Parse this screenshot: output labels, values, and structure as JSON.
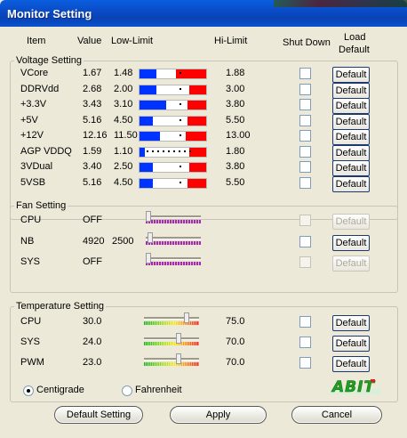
{
  "window": {
    "title": "Monitor Setting"
  },
  "headers": {
    "item": "Item",
    "value": "Value",
    "low_limit": "Low-Limit",
    "hi_limit": "Hi-Limit",
    "shut_down": "Shut Down",
    "load_default_1": "Load",
    "load_default_2": "Default"
  },
  "voltage": {
    "legend": "Voltage Setting",
    "rows": [
      {
        "item": "VCore",
        "value": "1.67",
        "low": "1.48",
        "hi": "1.88",
        "blue_pct": 0.25,
        "red_pct": 0.45,
        "default": "Default"
      },
      {
        "item": "DDRVdd",
        "value": "2.68",
        "low": "2.00",
        "hi": "3.00",
        "blue_pct": 0.25,
        "red_pct": 0.25,
        "default": "Default"
      },
      {
        "item": "+3.3V",
        "value": "3.43",
        "low": "3.10",
        "hi": "3.80",
        "blue_pct": 0.4,
        "red_pct": 0.28,
        "default": "Default"
      },
      {
        "item": "+5V",
        "value": "5.16",
        "low": "4.50",
        "hi": "5.50",
        "blue_pct": 0.2,
        "red_pct": 0.28,
        "default": "Default"
      },
      {
        "item": "+12V",
        "value": "12.16",
        "low": "11.50",
        "hi": "13.00",
        "blue_pct": 0.3,
        "red_pct": 0.3,
        "default": "Default"
      },
      {
        "item": "AGP VDDQ",
        "value": "1.59",
        "low": "1.10",
        "hi": "1.80",
        "blue_pct": 0.08,
        "red_pct": 0.25,
        "default": "Default"
      },
      {
        "item": "3VDual",
        "value": "3.40",
        "low": "2.50",
        "hi": "3.80",
        "blue_pct": 0.2,
        "red_pct": 0.25,
        "default": "Default"
      },
      {
        "item": "5VSB",
        "value": "5.16",
        "low": "4.50",
        "hi": "5.50",
        "blue_pct": 0.2,
        "red_pct": 0.28,
        "default": "Default"
      }
    ]
  },
  "fan": {
    "legend": "Fan Setting",
    "rows": [
      {
        "item": "CPU",
        "value": "OFF",
        "low": "",
        "default": "Default",
        "enabled": false
      },
      {
        "item": "NB",
        "value": "4920",
        "low": "2500",
        "default": "Default",
        "enabled": true
      },
      {
        "item": "SYS",
        "value": "OFF",
        "low": "",
        "default": "Default",
        "enabled": false
      }
    ]
  },
  "temperature": {
    "legend": "Temperature Setting",
    "rows": [
      {
        "item": "CPU",
        "value": "30.0",
        "hi": "75.0",
        "level": 0.78,
        "default": "Default"
      },
      {
        "item": "SYS",
        "value": "24.0",
        "hi": "70.0",
        "level": 0.62,
        "default": "Default"
      },
      {
        "item": "PWM",
        "value": "23.0",
        "hi": "70.0",
        "level": 0.62,
        "default": "Default"
      }
    ],
    "unit_centigrade": "Centigrade",
    "unit_fahrenheit": "Fahrenheit",
    "selected_unit": "Centigrade"
  },
  "logo": "ABIT",
  "buttons": {
    "default_setting": "Default Setting",
    "apply": "Apply",
    "cancel": "Cancel"
  }
}
